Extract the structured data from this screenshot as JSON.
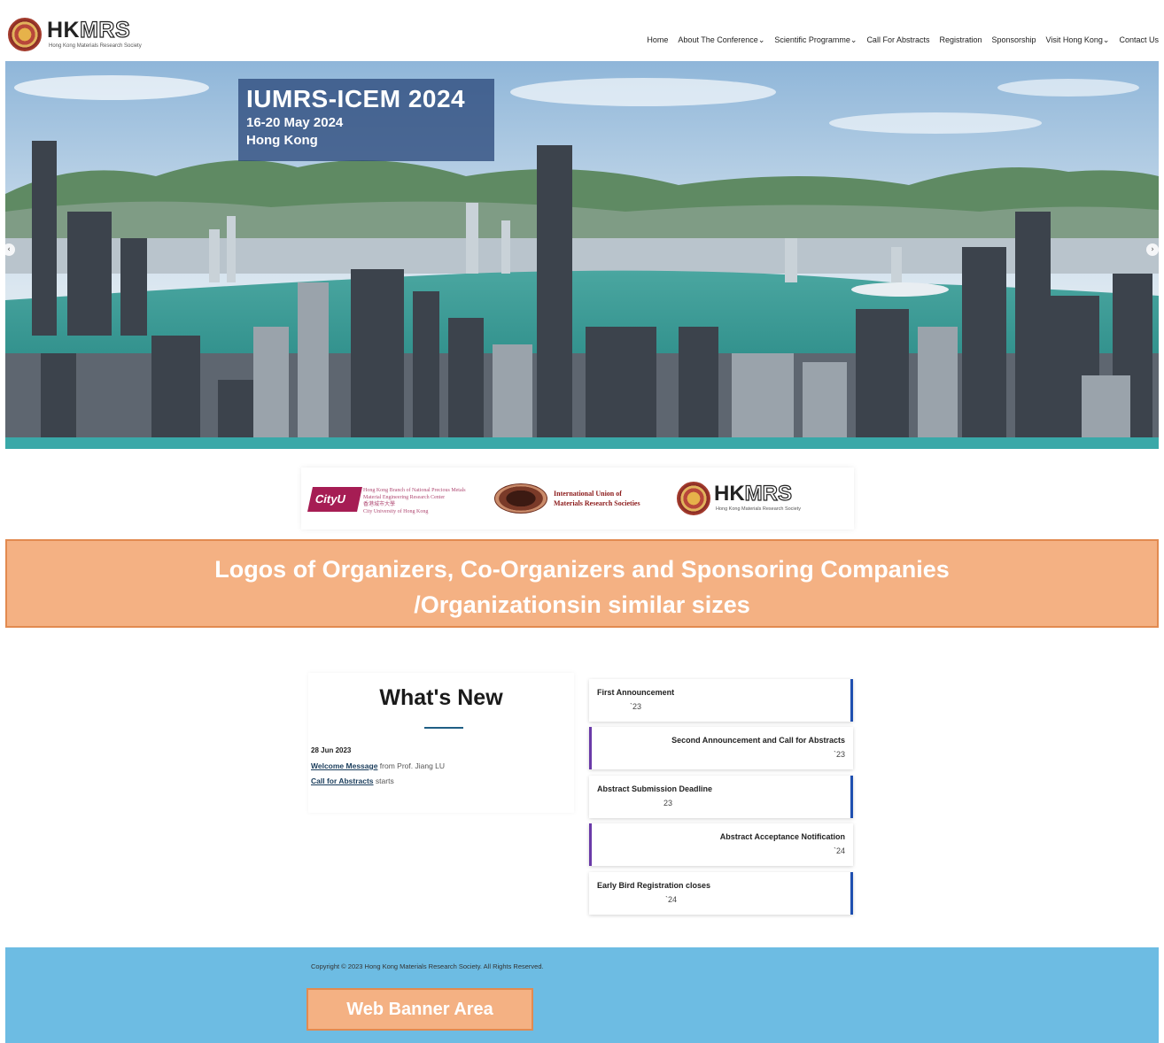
{
  "header": {
    "logo_text_solid": "HK",
    "logo_text_outline": "MRS",
    "logo_subtitle": "Hong Kong Materials Research Society",
    "nav": [
      {
        "label": "Home"
      },
      {
        "label": "About The Conference⌄"
      },
      {
        "label": "Scientific Programme⌄"
      },
      {
        "label": "Call For Abstracts"
      },
      {
        "label": "Registration"
      },
      {
        "label": "Sponsorship"
      },
      {
        "label": "Visit Hong Kong⌄"
      },
      {
        "label": "Contact Us"
      }
    ]
  },
  "hero": {
    "title": "IUMRS-ICEM 2024",
    "date": "16-20 May 2024",
    "place": "Hong Kong",
    "prev_arrow": "‹",
    "next_arrow": "›"
  },
  "logo_strip": {
    "cityu": "CityU",
    "cityu_line1": "Hong Kong Branch of National Precious Metals",
    "cityu_line2": "Material Engineering Research Center",
    "cityu_line3": "香港城市大學",
    "cityu_line4": "City University of Hong Kong",
    "iumrs_line1": "International Union of",
    "iumrs_line2": "Materials Research Societies",
    "hkmrs_solid": "HK",
    "hkmrs_outline": "MRS",
    "hkmrs_sub": "Hong Kong Materials Research Society"
  },
  "orange_banner": {
    "line1": "Logos of Organizers, Co-Organizers and Sponsoring Companies",
    "line2": "/Organizationsin similar sizes"
  },
  "whats_new": {
    "title": "What's New",
    "date": "28 Jun 2023",
    "item1_link": "Welcome Message",
    "item1_rest": " from Prof. Jiang LU",
    "item2_link": "Call for Abstracts",
    "item2_rest": " starts"
  },
  "timeline": [
    {
      "title": "First Announcement",
      "date": "`23"
    },
    {
      "title": "Second Announcement and Call for Abstracts",
      "date": "`23"
    },
    {
      "title": "Abstract Submission Deadline",
      "date": "23"
    },
    {
      "title": "Abstract Acceptance Notification",
      "date": "`24"
    },
    {
      "title": "Early Bird Registration closes",
      "date": "`24"
    }
  ],
  "footer": {
    "copyright": "Copyright © 2023 Hong Kong Materials Research Society. All Rights Reserved.",
    "web_banner": "Web Banner Area"
  },
  "colors": {
    "teal_bar": "#3aa8a8",
    "banner_orange": "#f4b183",
    "footer_blue": "#6dbce3",
    "timeline_right_accent": "#1f4fb0",
    "timeline_left_accent": "#6a3aa8"
  }
}
